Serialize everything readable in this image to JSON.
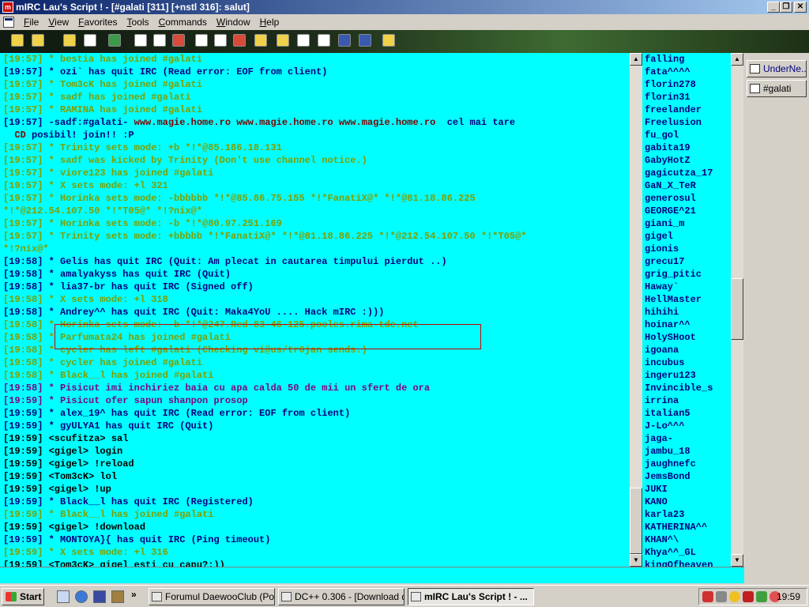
{
  "window": {
    "title": "mIRC Lau's Script ! - [#galati [311] [+nstl 316]: salut]",
    "app_icon_label": "m"
  },
  "menu": [
    "File",
    "View",
    "Favorites",
    "Tools",
    "Commands",
    "Window",
    "Help"
  ],
  "chat_lines": [
    {
      "parts": [
        {
          "t": "[19:57] * bestia has joined #galati",
          "c": "g"
        }
      ]
    },
    {
      "parts": [
        {
          "t": "[19:57] * ozi` has quit IRC (Read error: EOF from client)",
          "c": "n"
        }
      ]
    },
    {
      "parts": [
        {
          "t": "[19:57] * Tom3cK has joined #galati",
          "c": "g"
        }
      ]
    },
    {
      "parts": [
        {
          "t": "[19:57] * sadf has joined #galati",
          "c": "g"
        }
      ]
    },
    {
      "parts": [
        {
          "t": "[19:57] * RAMINA has joined #galati",
          "c": "g"
        }
      ]
    },
    {
      "parts": [
        {
          "t": "[19:57] -sadf:#galati- ",
          "c": "n"
        },
        {
          "t": "www.magie.home.ro www.magie.home.ro www.magie.home.ro",
          "c": "red"
        },
        {
          "t": "  cel mai tare",
          "c": "n"
        }
      ]
    },
    {
      "parts": [
        {
          "t": "  CD",
          "c": "red"
        },
        {
          "t": " posibil! join!! :P",
          "c": "n"
        }
      ]
    },
    {
      "parts": [
        {
          "t": "[19:57] * Trinity sets mode: +b *!*@85.186.18.131",
          "c": "g"
        }
      ]
    },
    {
      "parts": [
        {
          "t": "[19:57] * sadf was kicked by Trinity (Don't use channel notice.)",
          "c": "g"
        }
      ]
    },
    {
      "parts": [
        {
          "t": "[19:57] * viore123 has joined #galati",
          "c": "g"
        }
      ]
    },
    {
      "parts": [
        {
          "t": "[19:57] * X sets mode: +l 321",
          "c": "g"
        }
      ]
    },
    {
      "parts": [
        {
          "t": "[19:57] * Horinka sets mode: -bbbbbb *!*@85.86.75.155 *!*FanatiX@* *!*@81.18.86.225",
          "c": "g"
        }
      ]
    },
    {
      "parts": [
        {
          "t": "*!*@212.54.107.50 *!*T05@* *!?nix@*",
          "c": "g"
        }
      ]
    },
    {
      "parts": [
        {
          "t": "[19:57] * Horinka sets mode: -b *!*@80.97.251.169",
          "c": "g"
        }
      ]
    },
    {
      "parts": [
        {
          "t": "[19:57] * Trinity sets mode: +bbbbb *!*FanatiX@* *!*@81.18.86.225 *!*@212.54.107.50 *!*T05@*",
          "c": "g"
        }
      ]
    },
    {
      "parts": [
        {
          "t": "*!?nix@*",
          "c": "g"
        }
      ]
    },
    {
      "parts": [
        {
          "t": "[19:58] * Gelis has quit IRC (Quit: Am plecat in cautarea timpului pierdut ..)",
          "c": "n"
        }
      ]
    },
    {
      "parts": [
        {
          "t": "[19:58] * amalyakyss has quit IRC (Quit)",
          "c": "n"
        }
      ]
    },
    {
      "parts": [
        {
          "t": "[19:58] * lia37-br has quit IRC (Signed off)",
          "c": "n"
        }
      ]
    },
    {
      "parts": [
        {
          "t": "[19:58] * X sets mode: +l 318",
          "c": "g"
        }
      ]
    },
    {
      "parts": [
        {
          "t": "[19:58] * Andrey^^ has quit IRC (Quit: Maka4YoU .... Hack mIRC :)))",
          "c": "n"
        }
      ]
    },
    {
      "parts": [
        {
          "t": "[19:58] * Horinka sets mode: -b *!*@247.Red-83-46-125.pooles.rima-tde.net",
          "c": "g"
        }
      ]
    },
    {
      "parts": [
        {
          "t": "[19:58] * Parfumata24 has joined #galati",
          "c": "g"
        }
      ]
    },
    {
      "parts": [
        {
          "t": "[19:58] * cycler has left #galati (Checking vi@us/tr0jan sends.)",
          "c": "g"
        }
      ]
    },
    {
      "parts": [
        {
          "t": "[19:58] * cycler has joined #galati",
          "c": "g"
        }
      ]
    },
    {
      "parts": [
        {
          "t": "[19:58] * Black__l has joined #galati",
          "c": "g"
        }
      ]
    },
    {
      "parts": [
        {
          "t": "[19:58] * Pisicut imi inchiriez baia cu apa calda 50 de mii un sfert de ora",
          "c": "p"
        }
      ]
    },
    {
      "parts": [
        {
          "t": "[19:59] * Pisicut ofer sapun shanpon prosop",
          "c": "p"
        }
      ]
    },
    {
      "parts": [
        {
          "t": "[19:59] * alex_19^ has quit IRC (Read error: EOF from client)",
          "c": "n"
        }
      ]
    },
    {
      "parts": [
        {
          "t": "[19:59] * gyULYA1 has quit IRC (Quit)",
          "c": "n"
        }
      ]
    },
    {
      "parts": [
        {
          "t": "[19:59] <scufitza> sal",
          "c": "bk"
        }
      ]
    },
    {
      "parts": [
        {
          "t": "[19:59] <gigel> login",
          "c": "bk"
        }
      ]
    },
    {
      "parts": [
        {
          "t": "[19:59] <gigel> !reload",
          "c": "bk"
        }
      ]
    },
    {
      "parts": [
        {
          "t": "[19:59] <Tom3cK> lol",
          "c": "bk"
        }
      ]
    },
    {
      "parts": [
        {
          "t": "[19:59] <gigel> !up",
          "c": "bk"
        }
      ]
    },
    {
      "parts": [
        {
          "t": "[19:59] * Black__l has quit IRC (Registered)",
          "c": "n"
        }
      ]
    },
    {
      "parts": [
        {
          "t": "[19:59] * Black__l has joined #galati",
          "c": "g"
        }
      ]
    },
    {
      "parts": [
        {
          "t": "[19:59] <gigel> !download",
          "c": "bk"
        }
      ]
    },
    {
      "parts": [
        {
          "t": "[19:59] * MONTOYA}{ has quit IRC (Ping timeout)",
          "c": "n"
        }
      ]
    },
    {
      "parts": [
        {
          "t": "[19:59] * X sets mode: +l 316",
          "c": "g"
        }
      ]
    },
    {
      "parts": [
        {
          "t": "[19:59] <Tom3cK> gigel esti cu capu?:))",
          "c": "bk"
        }
      ]
    }
  ],
  "nicks": [
    "falling",
    "fata^^^^",
    "florin278",
    "florin31",
    "freelander",
    "Freelusion",
    "fu_gol",
    "gabita19",
    "GabyHotZ",
    "gagicutza_17",
    "GaN_X_TeR",
    "generosul",
    "GEORGE^21",
    "giani_m",
    "gigel",
    "gionis",
    "grecu17",
    "grig_pitic",
    "Haway`",
    "HellMaster",
    "hihihi",
    "hoinar^^",
    "HolySHoot",
    "igoana",
    "incubus",
    "ingeru123",
    "Invincible_s",
    "irrina",
    "italian5",
    "J-Lo^^^",
    "jaga-",
    "jambu_18",
    "jaughnefc",
    "JemsBond",
    "JUKI",
    "KANO",
    "karla23",
    "KATHERINA^^",
    "KHAN^\\",
    "Khya^^_GL",
    "kingOfheaven"
  ],
  "switchbar": [
    {
      "label": "UnderNe...",
      "active": true
    },
    {
      "label": "#galati",
      "active": false
    }
  ],
  "taskbar": {
    "start_label": "Start",
    "tasks": [
      {
        "label": "Forumul DaewooClub (Po...",
        "active": false
      },
      {
        "label": "DC++ 0.306 - [Download q...",
        "active": false
      },
      {
        "label": "mIRC Lau's Script ! - ...",
        "active": true
      }
    ],
    "quicklaunch_chevron": "»",
    "clock": "19:59"
  }
}
